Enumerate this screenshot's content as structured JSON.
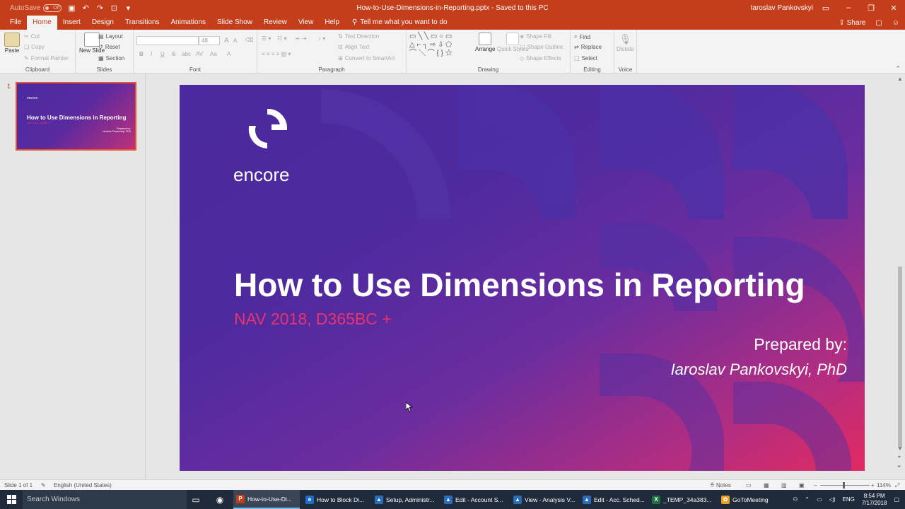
{
  "window": {
    "autosave_label": "AutoSave",
    "autosave_state": "Off",
    "title": "How-to-Use-Dimensions-in-Reporting.pptx  -  Saved to this PC",
    "user": "Iaroslav Pankovskyi"
  },
  "tabs": [
    "File",
    "Home",
    "Insert",
    "Design",
    "Transitions",
    "Animations",
    "Slide Show",
    "Review",
    "View",
    "Help"
  ],
  "active_tab": "Home",
  "tell_me": "Tell me what you want to do",
  "share_label": "Share",
  "ribbon": {
    "clipboard": {
      "label": "Clipboard",
      "paste": "Paste",
      "cut": "Cut",
      "copy": "Copy",
      "format_painter": "Format Painter"
    },
    "slides": {
      "label": "Slides",
      "new_slide": "New Slide",
      "layout": "Layout",
      "reset": "Reset",
      "section": "Section"
    },
    "font": {
      "label": "Font",
      "font_size": "48",
      "bold": "B",
      "italic": "I",
      "underline": "U",
      "strike": "S",
      "shadow": "abc",
      "spacing": "AV",
      "case": "Aa",
      "font_color": "A",
      "grow": "A",
      "shrink": "A"
    },
    "paragraph": {
      "label": "Paragraph",
      "text_direction": "Text Direction",
      "align_text": "Align Text",
      "convert_smartart": "Convert to SmartArt"
    },
    "drawing": {
      "label": "Drawing",
      "arrange": "Arrange",
      "quick_styles": "Quick Styles",
      "shape_fill": "Shape Fill",
      "shape_outline": "Shape Outline",
      "shape_effects": "Shape Effects"
    },
    "editing": {
      "label": "Editing",
      "find": "Find",
      "replace": "Replace",
      "select": "Select"
    },
    "voice": {
      "label": "Voice",
      "dictate": "Dictate"
    }
  },
  "thumbnail": {
    "number": "1",
    "logo": "encore",
    "title": "How to Use Dimensions in Reporting",
    "subtitle": "NAV 2018, D365BC +",
    "prepared": "Prepared by:",
    "author": "Iaroslav Pankovskyi, PhD"
  },
  "slide": {
    "logo_text": "encore",
    "title": "How to Use Dimensions in Reporting",
    "subtitle": "NAV 2018, D365BC +",
    "prepared_by": "Prepared by:",
    "author": "Iaroslav Pankovskyi, PhD"
  },
  "status": {
    "slide_count": "Slide 1 of 1",
    "language": "English (United States)",
    "notes": "Notes",
    "zoom": "114%"
  },
  "taskbar": {
    "search": "Search Windows",
    "apps": [
      {
        "label": "How-to-Use-Di...",
        "icon": "powerpoint-icon",
        "color": "#c43e1c",
        "glyph": "P"
      },
      {
        "label": "How to Block Di...",
        "icon": "edge-icon",
        "color": "#1e6ec8",
        "glyph": "e"
      },
      {
        "label": "Setup, Administr...",
        "icon": "dynamics-icon",
        "color": "#2a6ebb",
        "glyph": "▲"
      },
      {
        "label": "Edit - Account S...",
        "icon": "dynamics-icon",
        "color": "#2a6ebb",
        "glyph": "▲"
      },
      {
        "label": "View - Analysis V...",
        "icon": "dynamics-icon",
        "color": "#2a6ebb",
        "glyph": "▲"
      },
      {
        "label": "Edit - Acc. Sched...",
        "icon": "dynamics-icon",
        "color": "#2a6ebb",
        "glyph": "▲"
      },
      {
        "label": "_TEMP_34a383...",
        "icon": "excel-icon",
        "color": "#1e7145",
        "glyph": "X"
      },
      {
        "label": "GoToMeeting",
        "icon": "gotomeeting-icon",
        "color": "#f0a020",
        "glyph": "✿"
      }
    ],
    "language": "ENG",
    "time": "8:54 PM",
    "date": "7/17/2018"
  },
  "colors": {
    "accent": "#c43e1c",
    "slide_pink": "#e8336d",
    "slide_purple": "#4a2a9e"
  }
}
